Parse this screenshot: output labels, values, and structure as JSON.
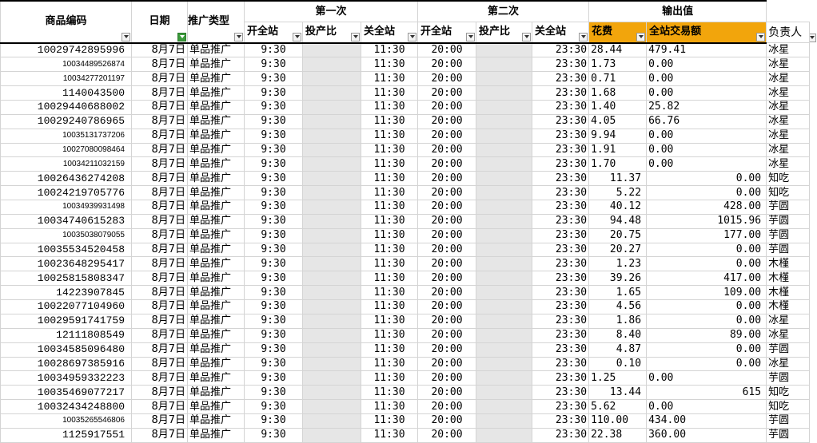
{
  "headers": {
    "item_code": "商品编码",
    "date": "日期",
    "promo_type": "推广类型",
    "group_first": "第一次",
    "group_second": "第二次",
    "group_output": "输出值",
    "first_open": "开全站",
    "first_invest": "投产比",
    "first_close": "关全站",
    "second_open": "开全站",
    "second_invest": "投产比",
    "second_close": "关全站",
    "cost": "花费",
    "gmv": "全站交易额",
    "owner": "负责人"
  },
  "rows": [
    {
      "id": "10029742895996",
      "id_small": false,
      "date": "8月7日",
      "type": "单品推广",
      "open1": "9:30",
      "close1": "11:30",
      "open2": "20:00",
      "close2": "23:30",
      "cost": "28.44",
      "gmv": "479.41",
      "align": "left",
      "owner": "冰星"
    },
    {
      "id": "10034489526874",
      "id_small": true,
      "date": "8月7日",
      "type": "单品推广",
      "open1": "9:30",
      "close1": "11:30",
      "open2": "20:00",
      "close2": "23:30",
      "cost": "1.73",
      "gmv": "0.00",
      "align": "left",
      "owner": "冰星"
    },
    {
      "id": "10034277201197",
      "id_small": true,
      "date": "8月7日",
      "type": "单品推广",
      "open1": "9:30",
      "close1": "11:30",
      "open2": "20:00",
      "close2": "23:30",
      "cost": "0.71",
      "gmv": "0.00",
      "align": "left",
      "owner": "冰星"
    },
    {
      "id": "1140043500",
      "id_small": false,
      "date": "8月7日",
      "type": "单品推广",
      "open1": "9:30",
      "close1": "11:30",
      "open2": "20:00",
      "close2": "23:30",
      "cost": "1.68",
      "gmv": "0.00",
      "align": "left",
      "owner": "冰星"
    },
    {
      "id": "10029440688002",
      "id_small": false,
      "date": "8月7日",
      "type": "单品推广",
      "open1": "9:30",
      "close1": "11:30",
      "open2": "20:00",
      "close2": "23:30",
      "cost": "1.40",
      "gmv": "25.82",
      "align": "left",
      "owner": "冰星"
    },
    {
      "id": "10029240786965",
      "id_small": false,
      "date": "8月7日",
      "type": "单品推广",
      "open1": "9:30",
      "close1": "11:30",
      "open2": "20:00",
      "close2": "23:30",
      "cost": "4.05",
      "gmv": "66.76",
      "align": "left",
      "owner": "冰星"
    },
    {
      "id": "10035131737206",
      "id_small": true,
      "date": "8月7日",
      "type": "单品推广",
      "open1": "9:30",
      "close1": "11:30",
      "open2": "20:00",
      "close2": "23:30",
      "cost": "9.94",
      "gmv": "0.00",
      "align": "left",
      "owner": "冰星"
    },
    {
      "id": "10027080098464",
      "id_small": true,
      "date": "8月7日",
      "type": "单品推广",
      "open1": "9:30",
      "close1": "11:30",
      "open2": "20:00",
      "close2": "23:30",
      "cost": "1.91",
      "gmv": "0.00",
      "align": "left",
      "owner": "冰星"
    },
    {
      "id": "10034211032159",
      "id_small": true,
      "date": "8月7日",
      "type": "单品推广",
      "open1": "9:30",
      "close1": "11:30",
      "open2": "20:00",
      "close2": "23:30",
      "cost": "1.70",
      "gmv": "0.00",
      "align": "left",
      "owner": "冰星"
    },
    {
      "id": "10026436274208",
      "id_small": false,
      "date": "8月7日",
      "type": "单品推广",
      "open1": "9:30",
      "close1": "11:30",
      "open2": "20:00",
      "close2": "23:30",
      "cost": "11.37",
      "gmv": "0.00",
      "align": "right",
      "owner": "知吃"
    },
    {
      "id": "10024219705776",
      "id_small": false,
      "date": "8月7日",
      "type": "单品推广",
      "open1": "9:30",
      "close1": "11:30",
      "open2": "20:00",
      "close2": "23:30",
      "cost": "5.22",
      "gmv": "0.00",
      "align": "right",
      "owner": "知吃"
    },
    {
      "id": "10034939931498",
      "id_small": true,
      "date": "8月7日",
      "type": "单品推广",
      "open1": "9:30",
      "close1": "11:30",
      "open2": "20:00",
      "close2": "23:30",
      "cost": "40.12",
      "gmv": "428.00",
      "align": "right",
      "owner": "芋圆"
    },
    {
      "id": "10034740615283",
      "id_small": false,
      "date": "8月7日",
      "type": "单品推广",
      "open1": "9:30",
      "close1": "11:30",
      "open2": "20:00",
      "close2": "23:30",
      "cost": "94.48",
      "gmv": "1015.96",
      "align": "right",
      "owner": "芋圆"
    },
    {
      "id": "10035038079055",
      "id_small": true,
      "date": "8月7日",
      "type": "单品推广",
      "open1": "9:30",
      "close1": "11:30",
      "open2": "20:00",
      "close2": "23:30",
      "cost": "20.75",
      "gmv": "177.00",
      "align": "right",
      "owner": "芋圆"
    },
    {
      "id": "10035534520458",
      "id_small": false,
      "date": "8月7日",
      "type": "单品推广",
      "open1": "9:30",
      "close1": "11:30",
      "open2": "20:00",
      "close2": "23:30",
      "cost": "20.27",
      "gmv": "0.00",
      "align": "right",
      "owner": "芋圆"
    },
    {
      "id": "10023648295417",
      "id_small": false,
      "date": "8月7日",
      "type": "单品推广",
      "open1": "9:30",
      "close1": "11:30",
      "open2": "20:00",
      "close2": "23:30",
      "cost": "1.23",
      "gmv": "0.00",
      "align": "right",
      "owner": "木槿"
    },
    {
      "id": "10025815808347",
      "id_small": false,
      "date": "8月7日",
      "type": "单品推广",
      "open1": "9:30",
      "close1": "11:30",
      "open2": "20:00",
      "close2": "23:30",
      "cost": "39.26",
      "gmv": "417.00",
      "align": "right",
      "owner": "木槿"
    },
    {
      "id": "14223907845",
      "id_small": false,
      "date": "8月7日",
      "type": "单品推广",
      "open1": "9:30",
      "close1": "11:30",
      "open2": "20:00",
      "close2": "23:30",
      "cost": "1.65",
      "gmv": "109.00",
      "align": "right",
      "owner": "木槿"
    },
    {
      "id": "10022077104960",
      "id_small": false,
      "date": "8月7日",
      "type": "单品推广",
      "open1": "9:30",
      "close1": "11:30",
      "open2": "20:00",
      "close2": "23:30",
      "cost": "4.56",
      "gmv": "0.00",
      "align": "right",
      "owner": "木槿"
    },
    {
      "id": "10029591741759",
      "id_small": false,
      "date": "8月7日",
      "type": "单品推广",
      "open1": "9:30",
      "close1": "11:30",
      "open2": "20:00",
      "close2": "23:30",
      "cost": "1.86",
      "gmv": "0.00",
      "align": "right",
      "owner": "冰星"
    },
    {
      "id": "12111808549",
      "id_small": false,
      "date": "8月7日",
      "type": "单品推广",
      "open1": "9:30",
      "close1": "11:30",
      "open2": "20:00",
      "close2": "23:30",
      "cost": "8.40",
      "gmv": "89.00",
      "align": "right",
      "owner": "冰星"
    },
    {
      "id": "10034585096480",
      "id_small": false,
      "date": "8月7日",
      "type": "单品推广",
      "open1": "9:30",
      "close1": "11:30",
      "open2": "20:00",
      "close2": "23:30",
      "cost": "4.87",
      "gmv": "0.00",
      "align": "right",
      "owner": "芋圆"
    },
    {
      "id": "10028697385916",
      "id_small": false,
      "date": "8月7日",
      "type": "单品推广",
      "open1": "9:30",
      "close1": "11:30",
      "open2": "20:00",
      "close2": "23:30",
      "cost": "0.10",
      "gmv": "0.00",
      "align": "right",
      "owner": "冰星"
    },
    {
      "id": "10034959332223",
      "id_small": false,
      "date": "8月7日",
      "type": "单品推广",
      "open1": "9:30",
      "close1": "11:30",
      "open2": "20:00",
      "close2": "23:30",
      "cost": "1.25",
      "gmv": "0.00",
      "align": "left",
      "owner": "芋圆"
    },
    {
      "id": "10035469077217",
      "id_small": false,
      "date": "8月7日",
      "type": "单品推广",
      "open1": "9:30",
      "close1": "11:30",
      "open2": "20:00",
      "close2": "23:30",
      "cost": "13.44",
      "gmv": "615",
      "align": "right",
      "owner": "知吃"
    },
    {
      "id": "10032434248800",
      "id_small": false,
      "date": "8月7日",
      "type": "单品推广",
      "open1": "9:30",
      "close1": "11:30",
      "open2": "20:00",
      "close2": "23:30",
      "cost": "5.62",
      "gmv": "0.00",
      "align": "left",
      "owner": "知吃"
    },
    {
      "id": "10035265546806",
      "id_small": true,
      "date": "8月7日",
      "type": "单品推广",
      "open1": "9:30",
      "close1": "11:30",
      "open2": "20:00",
      "close2": "23:30",
      "cost": "110.00",
      "gmv": "434.00",
      "align": "left",
      "owner": "芋圆"
    },
    {
      "id": "1125917551",
      "id_small": false,
      "date": "8月7日",
      "type": "单品推广",
      "open1": "9:30",
      "close1": "11:30",
      "open2": "20:00",
      "close2": "23:30",
      "cost": "22.38",
      "gmv": "360.00",
      "align": "left",
      "owner": "芋圆"
    }
  ]
}
